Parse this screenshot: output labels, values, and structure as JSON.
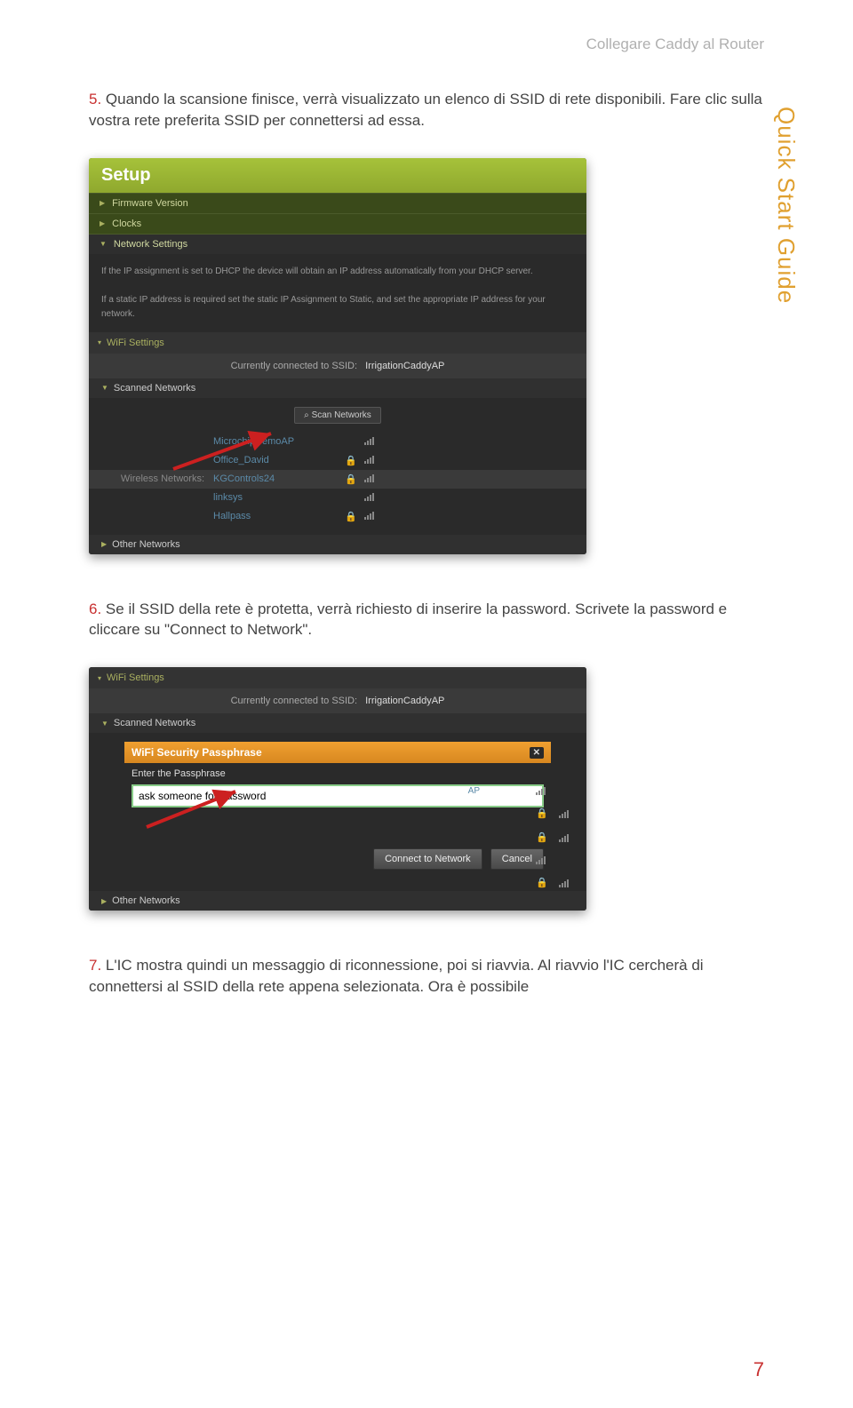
{
  "header": {
    "title": "Collegare Caddy al Router"
  },
  "sideLabel": "Quick Start Guide",
  "steps": {
    "s5": {
      "num": "5.",
      "text": "Quando la scansione finisce, verrà visualizzato un elenco di SSID di rete disponibili. Fare clic sulla vostra rete preferita SSID per connettersi ad essa."
    },
    "s6": {
      "num": "6.",
      "text": "Se il SSID della rete è protetta, verrà richiesto di inserire la password. Scrivete la password e cliccare su \"Connect to Network\"."
    },
    "s7": {
      "num": "7.",
      "text": "L'IC mostra quindi un messaggio di riconnessione, poi si riavvia. Al riavvio l'IC cercherà di connettersi al SSID della rete appena selezionata. Ora è possibile"
    }
  },
  "shot1": {
    "setup": "Setup",
    "rows": {
      "firmware": "Firmware Version",
      "clocks": "Clocks",
      "network": "Network Settings"
    },
    "info1": "If the IP assignment is set to DHCP the device will obtain an IP address automatically from your DHCP server.",
    "info2": "If a static IP address is required set the static IP Assignment to Static, and set the appropriate IP address for your network.",
    "wifi": "WiFi Settings",
    "ssidLabel": "Currently connected to SSID:",
    "ssidVal": "IrrigationCaddyAP",
    "scanned": "Scanned Networks",
    "scanBtn": "Scan Networks",
    "wirelessLabel": "Wireless Networks:",
    "nets": [
      {
        "ssid": "MicrochipDemoAP",
        "lock": false
      },
      {
        "ssid": "Office_David",
        "lock": true
      },
      {
        "ssid": "KGControls24",
        "lock": true,
        "sel": true
      },
      {
        "ssid": "linksys",
        "lock": false
      },
      {
        "ssid": "Hallpass",
        "lock": true
      }
    ],
    "other": "Other Networks"
  },
  "shot2": {
    "wifi": "WiFi Settings",
    "ssidLabel": "Currently connected to SSID:",
    "ssidVal": "IrrigationCaddyAP",
    "scanned": "Scanned Networks",
    "dialogTitle": "WiFi Security Passphrase",
    "dialogSub": "Enter the Passphrase",
    "pwValue": "ask someone for password",
    "apTag": "AP",
    "connectBtn": "Connect to Network",
    "cancelBtn": "Cancel",
    "other": "Other Networks"
  },
  "pageNumber": "7"
}
